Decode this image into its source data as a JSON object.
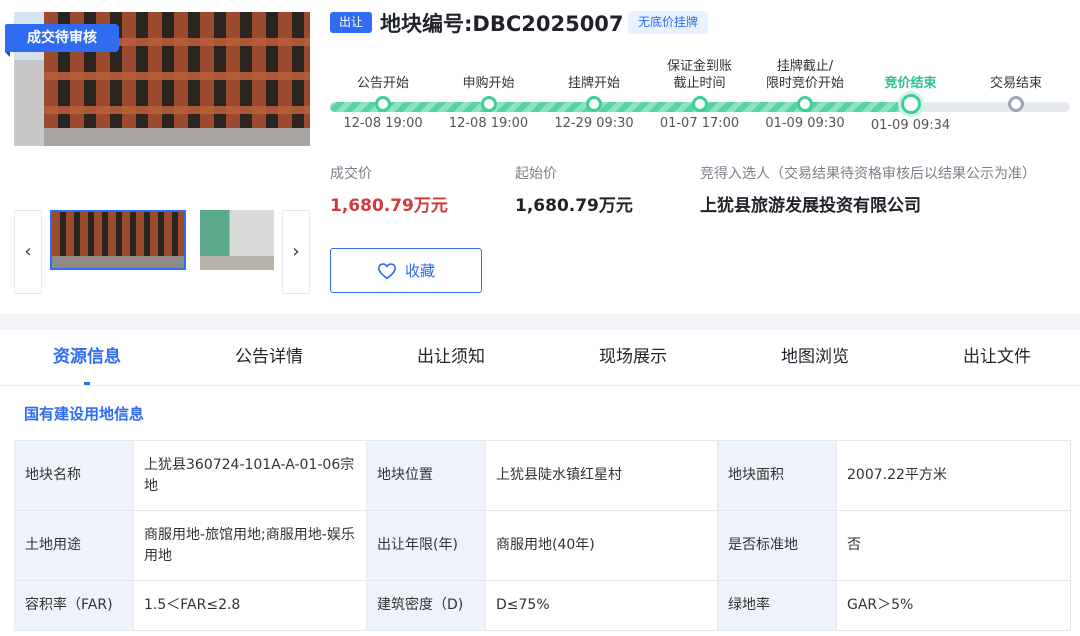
{
  "gallery": {
    "status_tag": "成交待审核",
    "prev_icon": "chevron-left-icon",
    "next_icon": "chevron-right-icon"
  },
  "header": {
    "type_badge": "出让",
    "title": "地块编号:DBC2025007",
    "tag": "无底价挂牌"
  },
  "timeline": {
    "progress": 0.786,
    "steps": [
      {
        "label": "公告开始",
        "time": "12-08 19:00",
        "state": "done"
      },
      {
        "label": "申购开始",
        "time": "12-08 19:00",
        "state": "done"
      },
      {
        "label": "挂牌开始",
        "time": "12-29 09:30",
        "state": "done"
      },
      {
        "label": "保证金到账\n截止时间",
        "time": "01-07 17:00",
        "state": "done"
      },
      {
        "label": "挂牌截止/\n限时竞价开始",
        "time": "01-09 09:30",
        "state": "done"
      },
      {
        "label": "竞价结束",
        "time": "01-09 09:34",
        "state": "current"
      },
      {
        "label": "交易结束",
        "time": "",
        "state": "pending"
      }
    ]
  },
  "prices": {
    "deal_label": "成交价",
    "deal_value": "1,680.79万元",
    "start_label": "起始价",
    "start_value": "1,680.79万元",
    "winner_label": "竞得入选人（交易结果待资格审核后以结果公示为准）",
    "winner_value": "上犹县旅游发展投资有限公司"
  },
  "favorite": {
    "label": "收藏",
    "icon": "heart-icon"
  },
  "tabs": [
    "资源信息",
    "公告详情",
    "出让须知",
    "现场展示",
    "地图浏览",
    "出让文件"
  ],
  "section": {
    "title": "国有建设用地信息"
  },
  "table": {
    "rows": [
      [
        "地块名称",
        "上犹县360724-101A-A-01-06宗地",
        "地块位置",
        "上犹县陡水镇红星村",
        "地块面积",
        "2007.22平方米"
      ],
      [
        "土地用途",
        "商服用地-旅馆用地;商服用地-娱乐用地",
        "出让年限(年)",
        "商服用地(40年)",
        "是否标准地",
        "否"
      ],
      [
        "容积率（FAR)",
        "1.5＜FAR≤2.8",
        "建筑密度（D)",
        "D≤75%",
        "绿地率",
        "GAR＞5%"
      ]
    ]
  },
  "colors": {
    "accent": "#2f6cf2",
    "success": "#3ccf97",
    "price_red": "#d23a3a"
  }
}
